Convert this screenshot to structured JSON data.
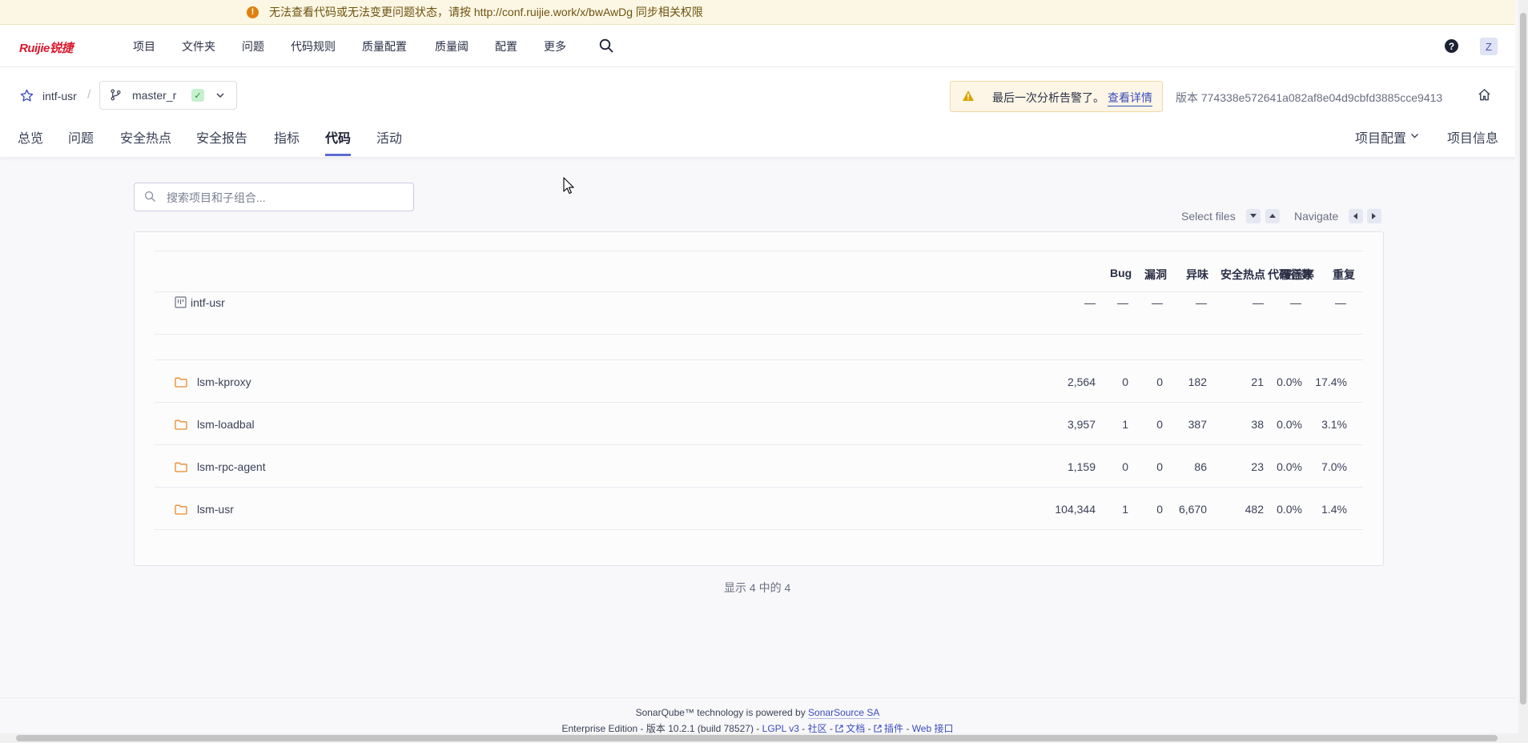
{
  "banner": {
    "text": "无法查看代码或无法变更问题状态，请按 http://conf.ruijie.work/x/bwAwDg 同步相关权限"
  },
  "topnav": {
    "logo": "Ruijie锐捷",
    "items": [
      "项目",
      "文件夹",
      "问题",
      "代码规则",
      "质量配置",
      "质量阈",
      "配置",
      "更多"
    ],
    "avatar": "Z"
  },
  "project": {
    "name": "intf-usr",
    "separator": "/",
    "branch": "master_r",
    "alert_text": "最后一次分析告警了。",
    "alert_link": "查看详情",
    "version": "版本 774338e572641a082af8e04d9cbfd3885cce9413"
  },
  "tabs": [
    "总览",
    "问题",
    "安全热点",
    "安全报告",
    "指标",
    "代码",
    "活动"
  ],
  "active_tab": "代码",
  "tabs_right": {
    "config": "项目配置",
    "info": "项目信息"
  },
  "search": {
    "placeholder": "搜索项目和子组合..."
  },
  "keyboard": {
    "select_files": "Select files",
    "navigate": "Navigate"
  },
  "table": {
    "columns": [
      "代码行数",
      "Bug",
      "漏洞",
      "异味",
      "安全热点",
      "覆盖率",
      "重复"
    ],
    "root": {
      "name": "intf-usr",
      "values": [
        "—",
        "—",
        "—",
        "—",
        "—",
        "—",
        "—"
      ]
    },
    "rows": [
      {
        "name": "lsm-kproxy",
        "values": [
          "2,564",
          "0",
          "0",
          "182",
          "21",
          "0.0%",
          "17.4%"
        ]
      },
      {
        "name": "lsm-loadbal",
        "values": [
          "3,957",
          "1",
          "0",
          "387",
          "38",
          "0.0%",
          "3.1%"
        ]
      },
      {
        "name": "lsm-rpc-agent",
        "values": [
          "1,159",
          "0",
          "0",
          "86",
          "23",
          "0.0%",
          "7.0%"
        ]
      },
      {
        "name": "lsm-usr",
        "values": [
          "104,344",
          "1",
          "0",
          "6,670",
          "482",
          "0.0%",
          "1.4%"
        ]
      }
    ]
  },
  "show_count": "显示 4 中的 4",
  "footer": {
    "powered_prefix": "SonarQube™ technology is powered by",
    "powered_link": "SonarSource SA",
    "edition": "Enterprise Edition - 版本 10.2.1 (build 78527) -",
    "license": "LGPL v3",
    "community": "社区",
    "docs": "文档",
    "plugins": "插件",
    "webapi": "Web 接口",
    "dash": "-"
  },
  "colors": {
    "accent": "#5d6cd0",
    "link": "#3a4cbc",
    "folder": "#e8892a",
    "ok": "#1d8b3a",
    "warn": "#e07f0e"
  }
}
